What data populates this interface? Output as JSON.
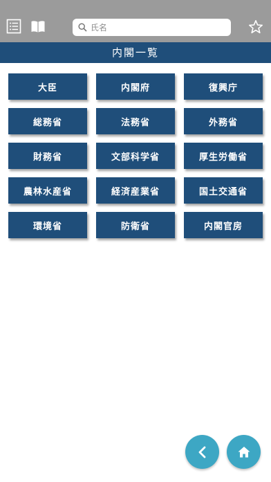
{
  "header": {
    "search_placeholder": "氏名",
    "icons": [
      "list-icon",
      "book-icon",
      "search-icon",
      "star-icon"
    ]
  },
  "page_title": "内閣一覧",
  "ministries": [
    "大臣",
    "内閣府",
    "復興庁",
    "総務省",
    "法務省",
    "外務省",
    "財務省",
    "文部科学省",
    "厚生労働省",
    "農林水産省",
    "経済産業省",
    "国土交通省",
    "環境省",
    "防衛省",
    "内閣官房"
  ],
  "footer": {
    "icons": [
      "back-icon",
      "home-icon"
    ]
  },
  "colors": {
    "topbar": "#9b9b9b",
    "navy": "#1f4e7a",
    "fab": "#3da7c4"
  }
}
